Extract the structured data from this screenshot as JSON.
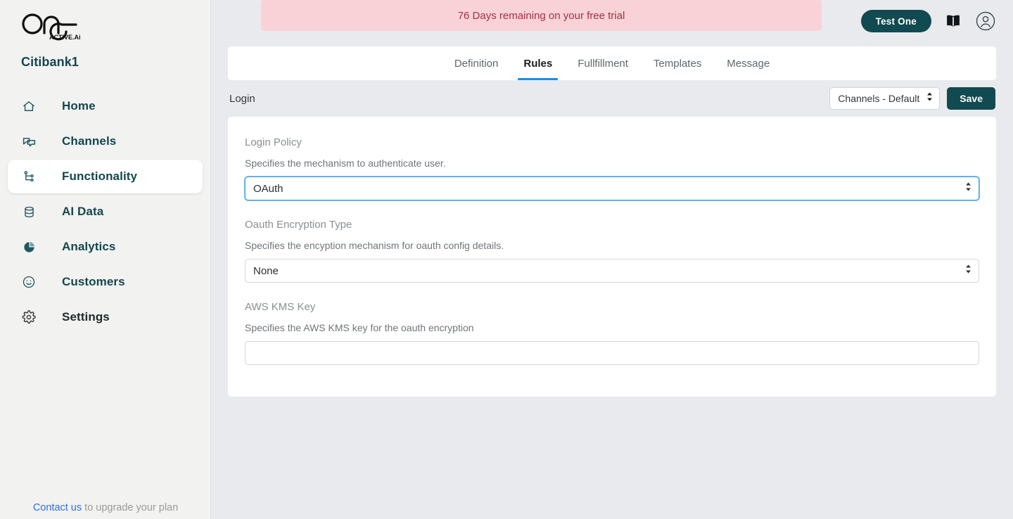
{
  "brand": {
    "logo_text": "one",
    "logo_subtext": "ACTIVE.Ai",
    "workspace": "Citibank1"
  },
  "sidebar": {
    "items": [
      {
        "label": "Home",
        "icon": "home-icon",
        "active": false
      },
      {
        "label": "Channels",
        "icon": "chat-bubbles-icon",
        "active": false
      },
      {
        "label": "Functionality",
        "icon": "node-tree-icon",
        "active": true
      },
      {
        "label": "AI Data",
        "icon": "database-icon",
        "active": false
      },
      {
        "label": "Analytics",
        "icon": "pie-chart-icon",
        "active": false
      },
      {
        "label": "Customers",
        "icon": "smiley-face-icon",
        "active": false
      },
      {
        "label": "Settings",
        "icon": "gear-icon",
        "active": false
      }
    ],
    "footer": {
      "link_text": "Contact us",
      "rest_text": " to upgrade your plan"
    }
  },
  "topbar": {
    "trial_banner": "76 Days remaining on your free trial",
    "test_button": "Test One",
    "book_icon": "book-icon",
    "account_icon": "user-avatar-icon"
  },
  "tabs": [
    {
      "label": "Definition",
      "active": false
    },
    {
      "label": "Rules",
      "active": true
    },
    {
      "label": "Fullfillment",
      "active": false
    },
    {
      "label": "Templates",
      "active": false
    },
    {
      "label": "Message",
      "active": false
    }
  ],
  "toolbar": {
    "title": "Login",
    "channel_select_value": "Channels - Default",
    "channel_select_options": [
      "Channels - Default"
    ],
    "save_label": "Save"
  },
  "form": {
    "fields": [
      {
        "label": "Login Policy",
        "description": "Specifies the mechanism to authenticate user.",
        "control": "select",
        "value": "OAuth",
        "options": [
          "OAuth"
        ],
        "focused": true
      },
      {
        "label": "Oauth Encryption Type",
        "description": "Specifies the encyption mechanism for oauth config details.",
        "control": "select",
        "value": "None",
        "options": [
          "None"
        ],
        "focused": false
      },
      {
        "label": "AWS KMS Key",
        "description": "Specifies the AWS KMS key for the oauth encryption",
        "control": "input",
        "value": "",
        "placeholder": "",
        "focused": false
      }
    ]
  },
  "colors": {
    "brand_dark": "#114a50",
    "sidebar_text": "#14474e",
    "accent_blue": "#1a8fe0",
    "banner_bg": "#f9d2d8",
    "banner_text": "#a33040",
    "page_bg": "#e9eaee",
    "link_blue": "#2f6fe4"
  }
}
